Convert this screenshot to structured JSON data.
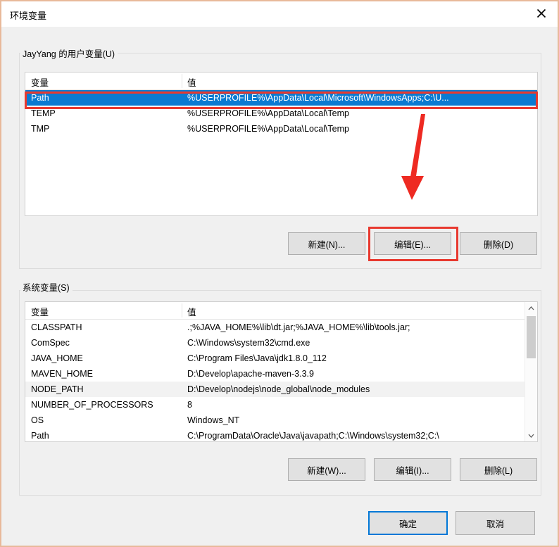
{
  "window": {
    "title": "环境变量",
    "close_icon": "close-icon"
  },
  "user_section": {
    "legend": "JayYang 的用户变量(U)",
    "columns": [
      "变量",
      "值"
    ],
    "rows": [
      {
        "name": "Path",
        "value": "%USERPROFILE%\\AppData\\Local\\Microsoft\\WindowsApps;C:\\U...",
        "selected": true
      },
      {
        "name": "TEMP",
        "value": "%USERPROFILE%\\AppData\\Local\\Temp",
        "selected": false
      },
      {
        "name": "TMP",
        "value": "%USERPROFILE%\\AppData\\Local\\Temp",
        "selected": false
      }
    ],
    "buttons": {
      "new": "新建(N)...",
      "edit": "编辑(E)...",
      "delete": "删除(D)"
    }
  },
  "system_section": {
    "legend": "系统变量(S)",
    "columns": [
      "变量",
      "值"
    ],
    "rows": [
      {
        "name": "CLASSPATH",
        "value": ".;%JAVA_HOME%\\lib\\dt.jar;%JAVA_HOME%\\lib\\tools.jar;",
        "hovered": false
      },
      {
        "name": "ComSpec",
        "value": "C:\\Windows\\system32\\cmd.exe",
        "hovered": false
      },
      {
        "name": "JAVA_HOME",
        "value": "C:\\Program Files\\Java\\jdk1.8.0_112",
        "hovered": false
      },
      {
        "name": "MAVEN_HOME",
        "value": "D:\\Develop\\apache-maven-3.3.9",
        "hovered": false
      },
      {
        "name": "NODE_PATH",
        "value": "D:\\Develop\\nodejs\\node_global\\node_modules",
        "hovered": true
      },
      {
        "name": "NUMBER_OF_PROCESSORS",
        "value": "8",
        "hovered": false
      },
      {
        "name": "OS",
        "value": "Windows_NT",
        "hovered": false
      },
      {
        "name": "Path",
        "value": "C:\\ProgramData\\Oracle\\Java\\javapath;C:\\Windows\\system32;C:\\",
        "hovered": false
      }
    ],
    "buttons": {
      "new": "新建(W)...",
      "edit": "编辑(I)...",
      "delete": "删除(L)"
    }
  },
  "dialog_buttons": {
    "ok": "确定",
    "cancel": "取消"
  },
  "annotations": {
    "accent_color": "#e8392f",
    "selection_color": "#0b7ad1",
    "focus_color": "#0078d7"
  }
}
